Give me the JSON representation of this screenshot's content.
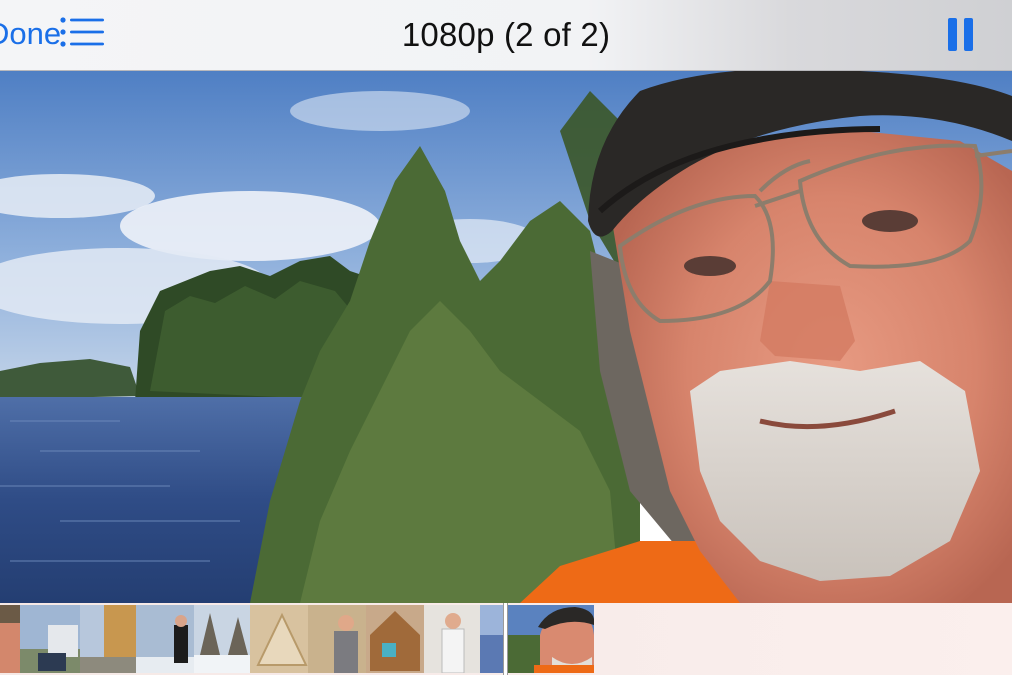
{
  "navbar": {
    "done_label": "Done",
    "title": "1080p (2 of 2)",
    "list_icon": "list-icon",
    "pause_icon": "pause-icon"
  },
  "video": {
    "description_icon": "video-frame"
  },
  "filmstrip": {
    "thumbnail_count": 11,
    "accent_color": "#1a6fe8"
  }
}
